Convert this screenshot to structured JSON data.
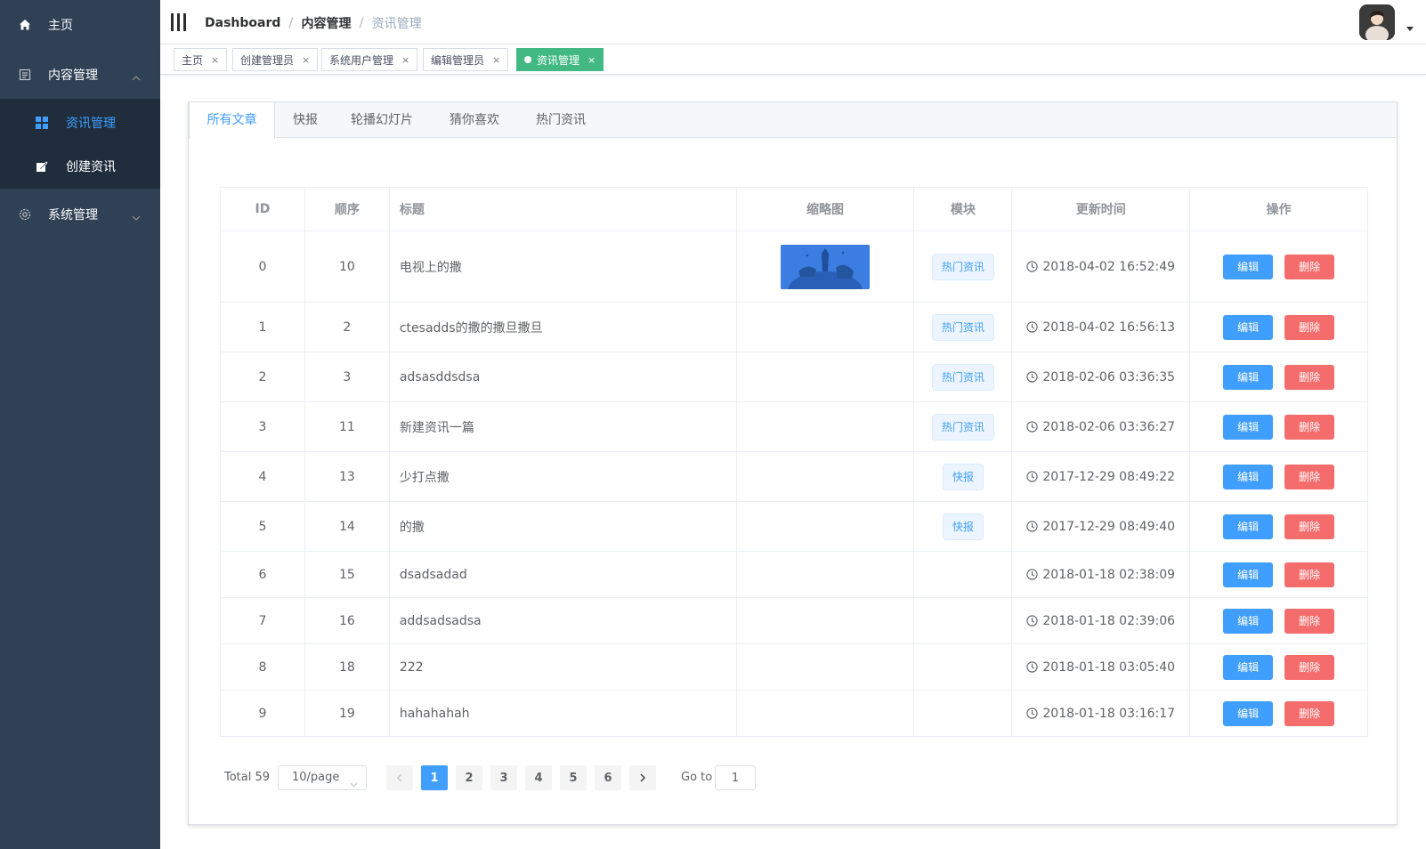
{
  "sidebar": {
    "items": [
      {
        "label": "主页",
        "icon": "home-icon"
      },
      {
        "label": "内容管理",
        "icon": "document-icon"
      },
      {
        "label": "系统管理",
        "icon": "gear-icon"
      }
    ],
    "submenu": [
      {
        "label": "资讯管理",
        "icon": "grid-icon",
        "active": true
      },
      {
        "label": "创建资讯",
        "icon": "edit-icon"
      }
    ]
  },
  "breadcrumb": {
    "items": [
      "Dashboard",
      "内容管理",
      "资讯管理"
    ],
    "separator": "/"
  },
  "tags": [
    {
      "label": "主页",
      "close": "×"
    },
    {
      "label": "创建管理员",
      "close": "×"
    },
    {
      "label": "系统用户管理",
      "close": "×"
    },
    {
      "label": "编辑管理员",
      "close": "×"
    },
    {
      "label": "资讯管理",
      "close": "×",
      "active": true
    }
  ],
  "tabs": [
    "所有文章",
    "快报",
    "轮播幻灯片",
    "猜你喜欢",
    "热门资讯"
  ],
  "table": {
    "headers": [
      "ID",
      "顺序",
      "标题",
      "缩略图",
      "模块",
      "更新时间",
      "操作"
    ],
    "rows": [
      {
        "id": "0",
        "order": "10",
        "title": "电视上的撒",
        "thumb": true,
        "module": "热门资讯",
        "time": "2018-04-02 16:52:49"
      },
      {
        "id": "1",
        "order": "2",
        "title": "ctesadds的撒的撒旦撒旦",
        "thumb": false,
        "module": "热门资讯",
        "time": "2018-04-02 16:56:13"
      },
      {
        "id": "2",
        "order": "3",
        "title": "adsasddsdsa",
        "thumb": false,
        "module": "热门资讯",
        "time": "2018-02-06 03:36:35"
      },
      {
        "id": "3",
        "order": "11",
        "title": "新建资讯一篇",
        "thumb": false,
        "module": "热门资讯",
        "time": "2018-02-06 03:36:27"
      },
      {
        "id": "4",
        "order": "13",
        "title": "少打点撒",
        "thumb": false,
        "module": "快报",
        "time": "2017-12-29 08:49:22"
      },
      {
        "id": "5",
        "order": "14",
        "title": "的撒",
        "thumb": false,
        "module": "快报",
        "time": "2017-12-29 08:49:40"
      },
      {
        "id": "6",
        "order": "15",
        "title": "dsadsadad",
        "thumb": false,
        "module": "",
        "time": "2018-01-18 02:38:09"
      },
      {
        "id": "7",
        "order": "16",
        "title": "addsadsadsa",
        "thumb": false,
        "module": "",
        "time": "2018-01-18 02:39:06"
      },
      {
        "id": "8",
        "order": "18",
        "title": "222",
        "thumb": false,
        "module": "",
        "time": "2018-01-18 03:05:40"
      },
      {
        "id": "9",
        "order": "19",
        "title": "hahahahah",
        "thumb": false,
        "module": "",
        "time": "2018-01-18 03:16:17"
      }
    ],
    "edit_label": "编辑",
    "delete_label": "删除"
  },
  "pagination": {
    "total": "Total 59",
    "page_size": "10/page",
    "pages": [
      "1",
      "2",
      "3",
      "4",
      "5",
      "6"
    ],
    "current": "1",
    "goto_label": "Go to",
    "goto_value": "1"
  },
  "colors": {
    "sidebar_bg": "#304156",
    "submenu_bg": "#1f2d3d",
    "accent": "#409eff",
    "danger": "#f56c6c",
    "active_tag": "#42b983"
  }
}
